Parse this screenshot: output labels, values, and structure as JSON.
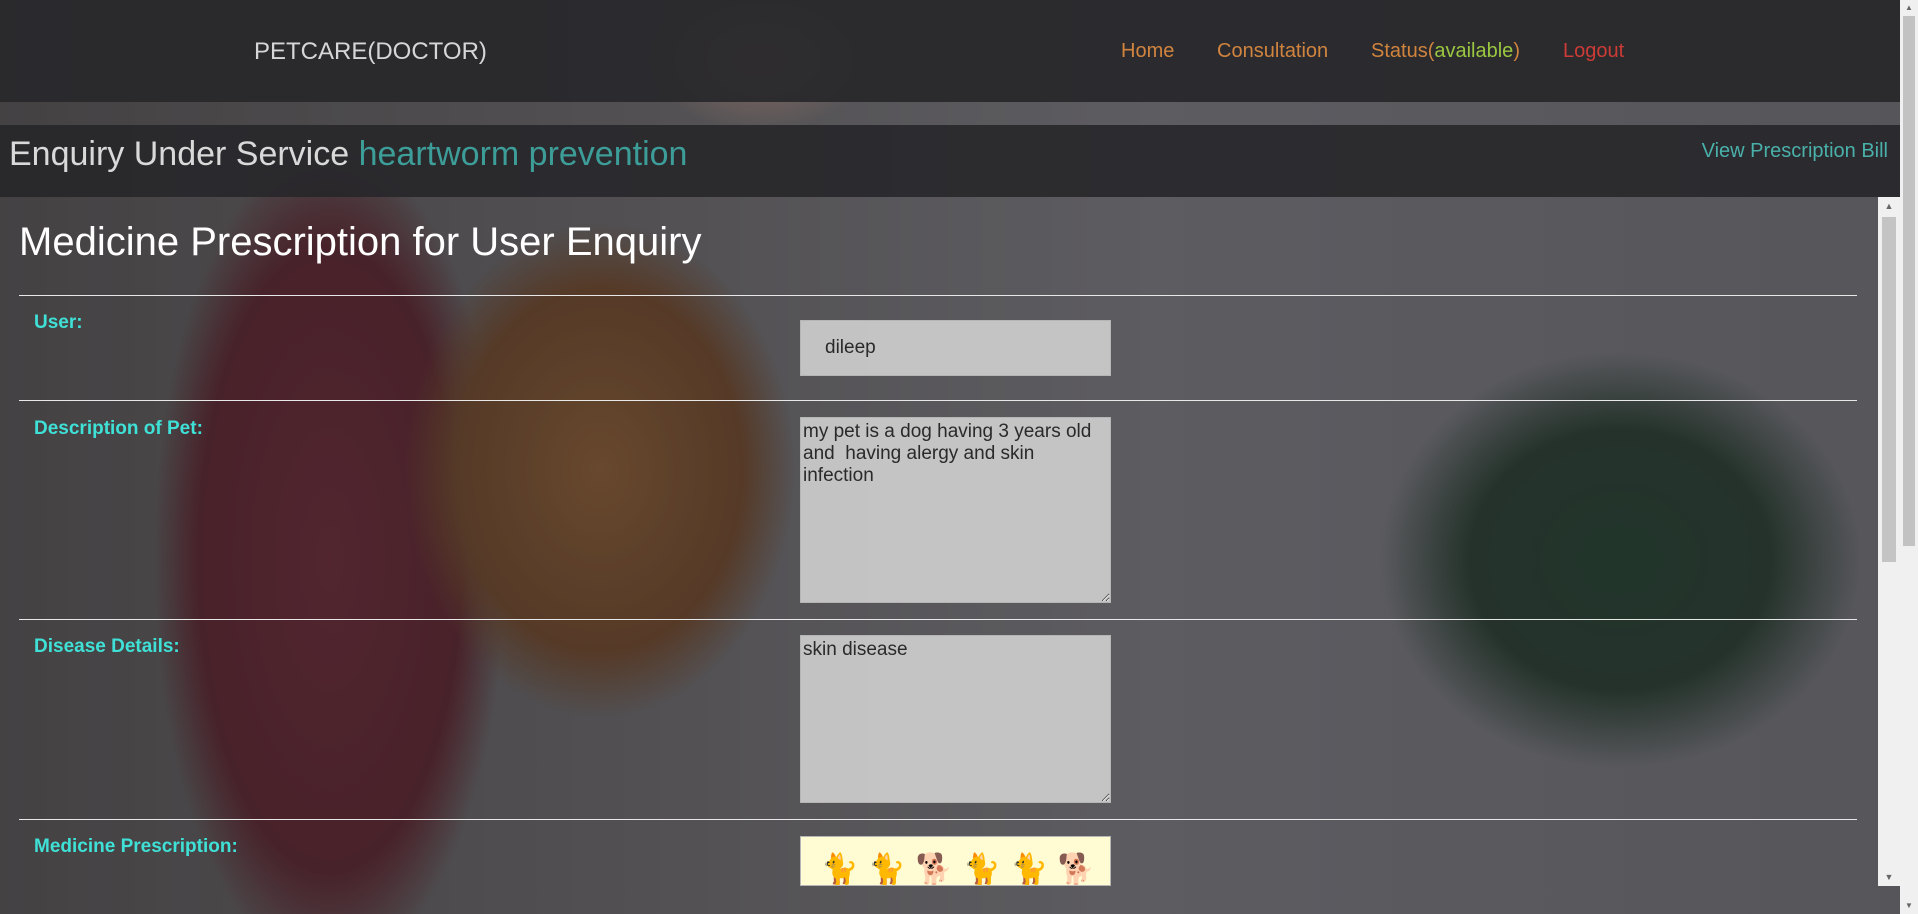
{
  "header": {
    "brand": "PETCARE(DOCTOR)",
    "nav": {
      "home": "Home",
      "consultation": "Consultation",
      "status_prefix": "Status(",
      "status_value": "available",
      "status_suffix": ")",
      "logout": "Logout"
    }
  },
  "subheader": {
    "title_prefix": "Enquiry Under Service",
    "service": "heartworm prevention",
    "view_bill": "View Prescription Bill"
  },
  "form": {
    "heading": "Medicine Prescription for User Enquiry",
    "user_label": "User:",
    "user_value": "dileep",
    "pet_desc_label": "Description of Pet:",
    "pet_desc_value": "my pet is a dog having 3 years old and  having alergy and skin infection",
    "disease_label": "Disease Details:",
    "disease_value": "skin disease",
    "rx_label": "Medicine Prescription:"
  },
  "colors": {
    "nav_link": "#d1843e",
    "logout": "#cc3b35",
    "available": "#9ac640",
    "service": "#3d9d98",
    "label": "#3fe0d6"
  }
}
